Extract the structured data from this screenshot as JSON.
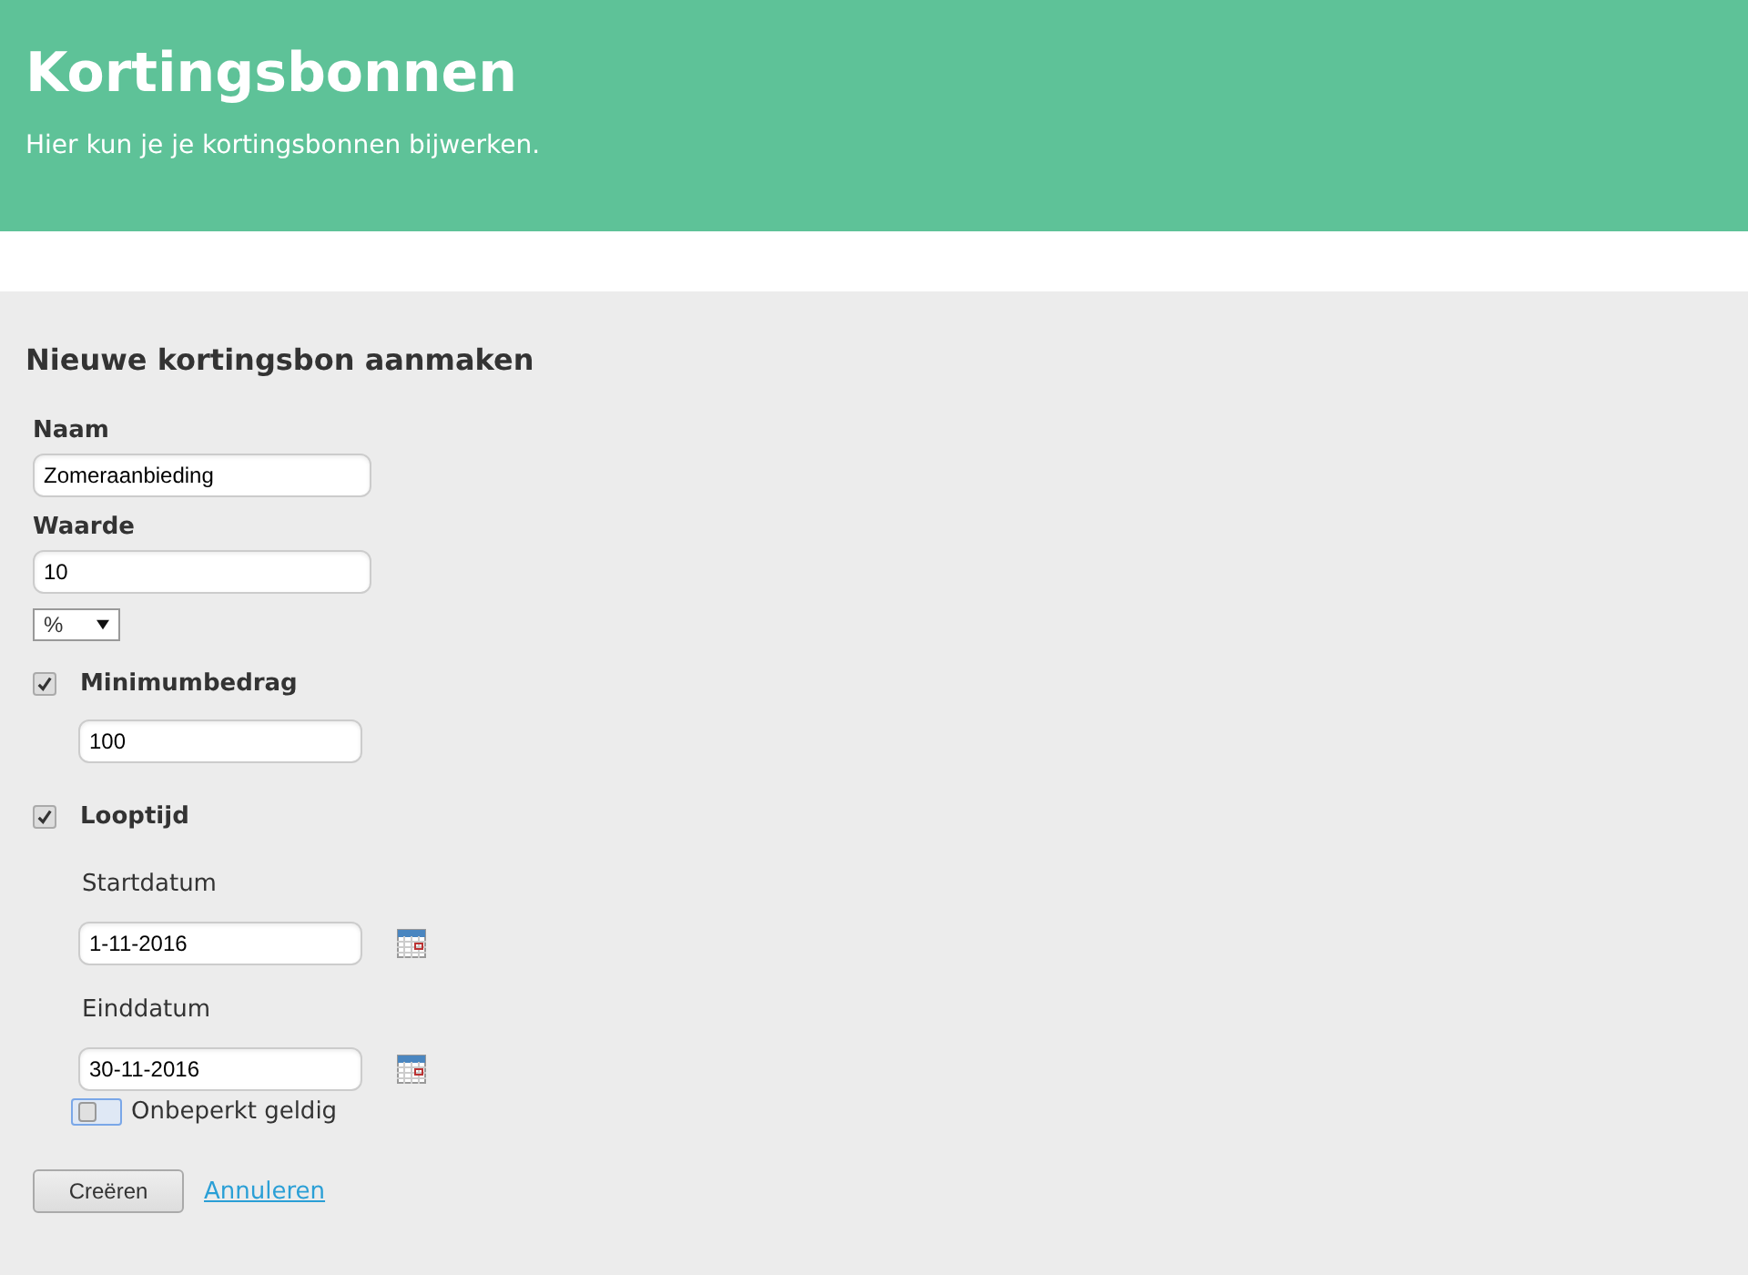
{
  "header": {
    "title": "Kortingsbonnen",
    "subtitle": "Hier kun je je kortingsbonnen bijwerken."
  },
  "form": {
    "title": "Nieuwe kortingsbon aanmaken",
    "name": {
      "label": "Naam",
      "value": "Zomeraanbieding"
    },
    "amount": {
      "label": "Waarde",
      "value": "10",
      "unit": "%"
    },
    "minimum": {
      "label": "Minimumbedrag",
      "checked": true,
      "value": "100"
    },
    "duration": {
      "label": "Looptijd",
      "checked": true,
      "start_label": "Startdatum",
      "start_value": "1-11-2016",
      "end_label": "Einddatum",
      "end_value": "30-11-2016",
      "unlimited": {
        "label": "Onbeperkt geldig",
        "checked": false
      }
    },
    "submit": "Creëren",
    "cancel": "Annuleren"
  }
}
